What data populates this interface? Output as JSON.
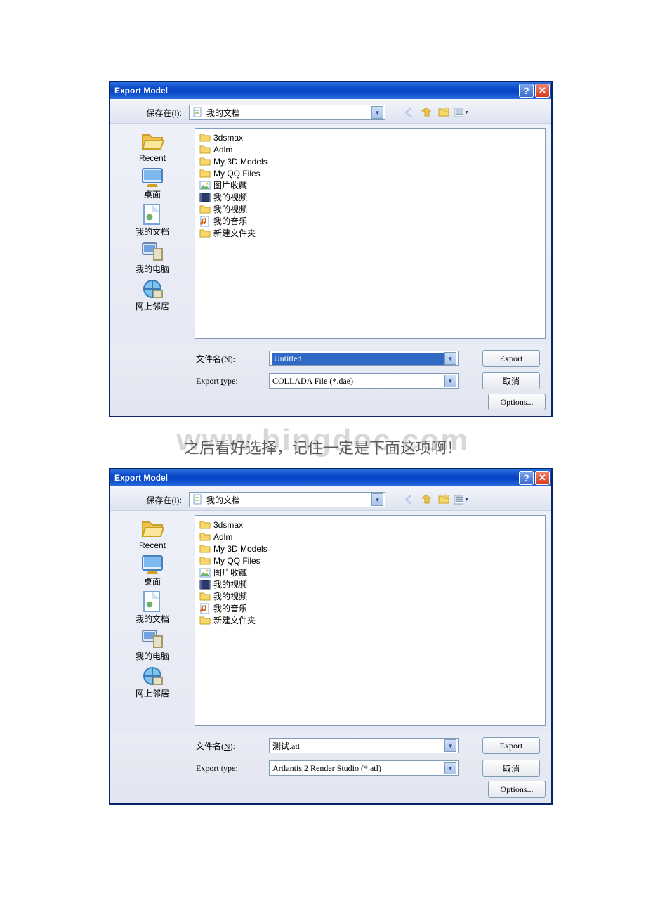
{
  "dialog": {
    "title": "Export Model",
    "save_in_label": "保存在(I):",
    "location_value": "我的文档",
    "filename_label": "文件名(N):",
    "type_label": "Export type:",
    "export_btn": "Export",
    "cancel_btn": "取消",
    "options_btn": "Options..."
  },
  "places": [
    {
      "label": "Recent",
      "icon": "folder"
    },
    {
      "label": "桌面",
      "icon": "desktop"
    },
    {
      "label": "我的文档",
      "icon": "mydocs"
    },
    {
      "label": "我的电脑",
      "icon": "computer"
    },
    {
      "label": "网上邻居",
      "icon": "network"
    }
  ],
  "files": [
    {
      "name": "3dsmax",
      "icon": "folder"
    },
    {
      "name": "Adlm",
      "icon": "folder"
    },
    {
      "name": "My 3D Models",
      "icon": "folder"
    },
    {
      "name": "My QQ Files",
      "icon": "folder"
    },
    {
      "name": "图片收藏",
      "icon": "pictures"
    },
    {
      "name": "我的视频",
      "icon": "video-dark"
    },
    {
      "name": "我的视频",
      "icon": "folder"
    },
    {
      "name": "我的音乐",
      "icon": "music"
    },
    {
      "name": "新建文件夹",
      "icon": "folder"
    }
  ],
  "first": {
    "filename": "Untitled",
    "type": "COLLADA File (*.dae)",
    "filename_selected": true
  },
  "second": {
    "filename": "测试.atl",
    "type": "Artlantis 2 Render Studio (*.atl)",
    "filename_selected": false
  },
  "mid_text": "之后看好选择，记住一定是下面这项啊！",
  "watermark_big": "www.bingdoc.com"
}
